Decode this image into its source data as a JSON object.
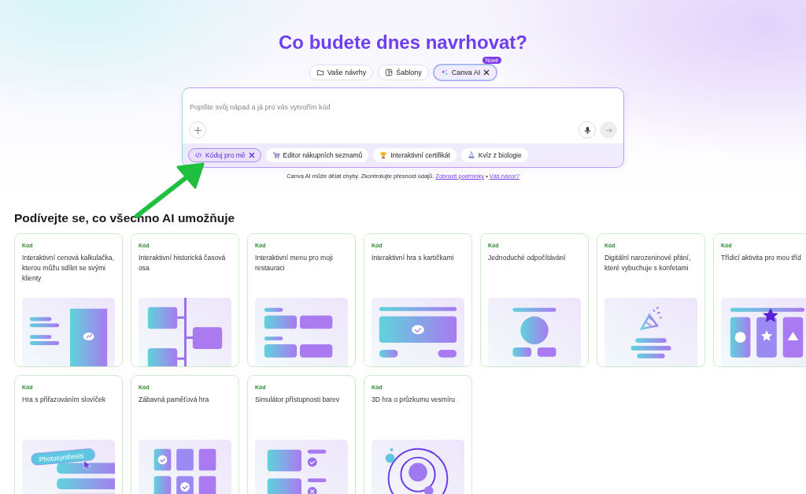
{
  "title": "Co budete dnes navrhovat?",
  "tabs": [
    {
      "label": "Vaše návrhy",
      "selected": false
    },
    {
      "label": "Šablony",
      "selected": false
    },
    {
      "label": "Canva AI",
      "selected": true,
      "badge": "Nové"
    }
  ],
  "prompt": {
    "placeholder": "Popište svůj nápad a já pro vás vytvořím kód"
  },
  "suggestions": [
    {
      "label": "Kóduj pro mě",
      "selected": true
    },
    {
      "label": "Editor nákupních seznamů",
      "selected": false
    },
    {
      "label": "Interaktivní certifikát",
      "selected": false
    },
    {
      "label": "Kvíz z biologie",
      "selected": false
    }
  ],
  "disclaimer": {
    "text": "Canva AI může dělat chyby. Zkontrolujte přesnost údajů.",
    "links": [
      "Zobrazit podmínky",
      "Váš názor?"
    ],
    "separator": "•"
  },
  "section_title": "Podívejte se, co všechno AI umožňuje",
  "cards": [
    {
      "tag": "Kód",
      "title": "Interaktivní cenová kalkulačka, kterou můžu sdílet se svými klienty"
    },
    {
      "tag": "Kód",
      "title": "Interaktivní historická časová osa"
    },
    {
      "tag": "Kód",
      "title": "Interaktivní menu pro moji restauraci"
    },
    {
      "tag": "Kód",
      "title": "Interaktivní hra s kartičkami"
    },
    {
      "tag": "Kód",
      "title": "Jednoduché odpočítávání"
    },
    {
      "tag": "Kód",
      "title": "Digitální narozeninové přání, které vybuchuje s konfetami"
    },
    {
      "tag": "Kód",
      "title": "Třídicí aktivita pro mou tříd"
    },
    {
      "tag": "Kód",
      "title": "Hra s přiřazováním slovíček",
      "illustration_label": "Photosynthesis"
    },
    {
      "tag": "Kód",
      "title": "Zábavná paměťová hra"
    },
    {
      "tag": "Kód",
      "title": "Simulátor přístupnosti barev"
    },
    {
      "tag": "Kód",
      "title": "3D hra o průzkumu vesmíru"
    }
  ]
}
